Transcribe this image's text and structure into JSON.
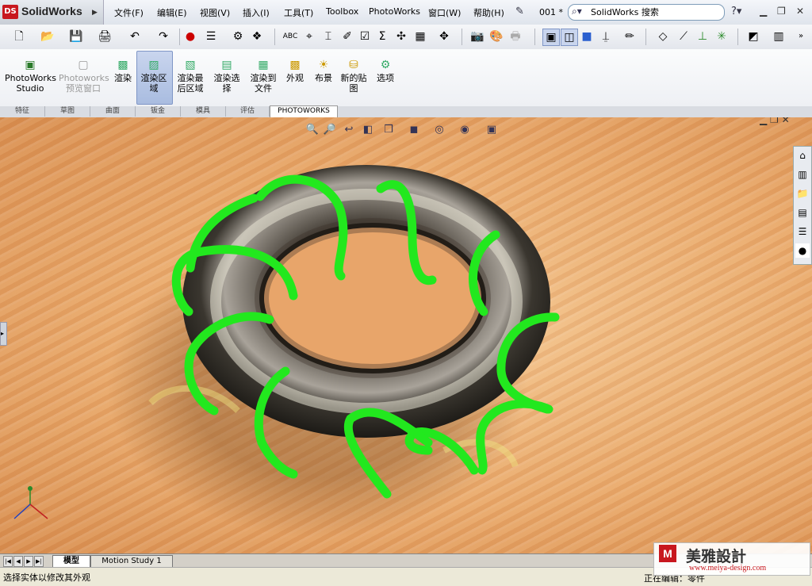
{
  "app": {
    "name": "SolidWorks",
    "logo_text": "DS",
    "document": "001 *",
    "search_placeholder": "SolidWorks 搜索"
  },
  "menu": [
    "文件(F)",
    "编辑(E)",
    "视图(V)",
    "插入(I)",
    "工具(T)",
    "Toolbox",
    "PhotoWorks",
    "窗口(W)",
    "帮助(H)"
  ],
  "toolbar_icons": [
    "new-icon",
    "open-icon",
    "save-icon",
    "print-icon",
    "undo-icon",
    "redo-icon",
    "rebuild-icon",
    "options-icon",
    "file-properties-icon",
    "select-icon",
    "spell-check-icon",
    "dimension-icon",
    "smart-dimension-icon",
    "note-icon",
    "checkbox-icon",
    "sum-icon",
    "equation-icon",
    "grid-icon",
    "camera-icon",
    "photo-icon",
    "printer-icon"
  ],
  "commands": [
    {
      "label": "PhotoWorks\nStudio",
      "icon": "studio-icon",
      "enabled": true
    },
    {
      "label": "Photoworks\n预览窗口",
      "icon": "preview-window-icon",
      "enabled": false
    },
    {
      "label": "渲染",
      "icon": "render-icon",
      "enabled": true
    },
    {
      "label": "渲染区\n域",
      "icon": "render-region-icon",
      "enabled": true,
      "active": true
    },
    {
      "label": "渲染最\n后区域",
      "icon": "render-last-region-icon",
      "enabled": true
    },
    {
      "label": "渲染选\n择",
      "icon": "render-selection-icon",
      "enabled": true
    },
    {
      "label": "渲染到\n文件",
      "icon": "render-to-file-icon",
      "enabled": true
    },
    {
      "label": "外观",
      "icon": "appearance-icon",
      "enabled": true
    },
    {
      "label": "布景",
      "icon": "scene-icon",
      "enabled": true
    },
    {
      "label": "新的贴\n图",
      "icon": "new-decal-icon",
      "enabled": true
    },
    {
      "label": "选项",
      "icon": "options-icon",
      "enabled": true
    }
  ],
  "command_tabs": [
    "特征",
    "草图",
    "曲面",
    "钣金",
    "模具",
    "评估",
    "PHOTOWORKS"
  ],
  "active_command_tab": "PHOTOWORKS",
  "bottom_tabs": [
    "模型",
    "Motion Study 1"
  ],
  "active_bottom_tab": "模型",
  "status": {
    "message": "选择实体以修改其外观",
    "editing": "正在编辑：零件"
  },
  "watermark": {
    "brand": "美雅設計",
    "url": "www.meiya-design.com"
  },
  "colors": {
    "coil": "#22e81e",
    "torus": "#2e2a24",
    "wood": "#eaa86a"
  }
}
